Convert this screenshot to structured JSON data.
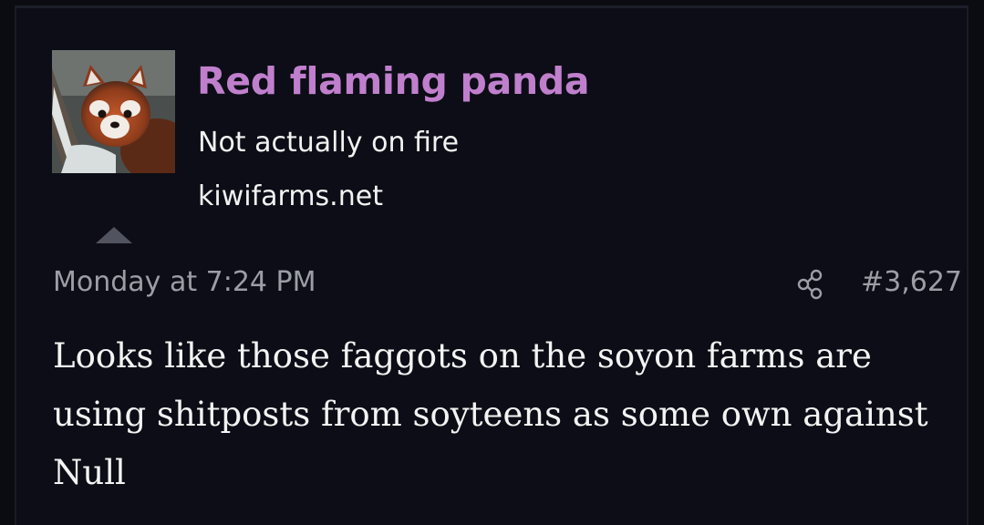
{
  "post": {
    "author": {
      "username": "Red flaming panda",
      "title": "Not actually on fire",
      "site": "kiwifarms.net",
      "avatar_icon": "red-panda-avatar",
      "username_color": "#c07fcd"
    },
    "date": "Monday at 7:24 PM",
    "share_icon": "share-icon",
    "number": "#3,627",
    "body": "Looks like those faggots on the soyon farms are using shitposts from soyteens as some own against Null"
  }
}
